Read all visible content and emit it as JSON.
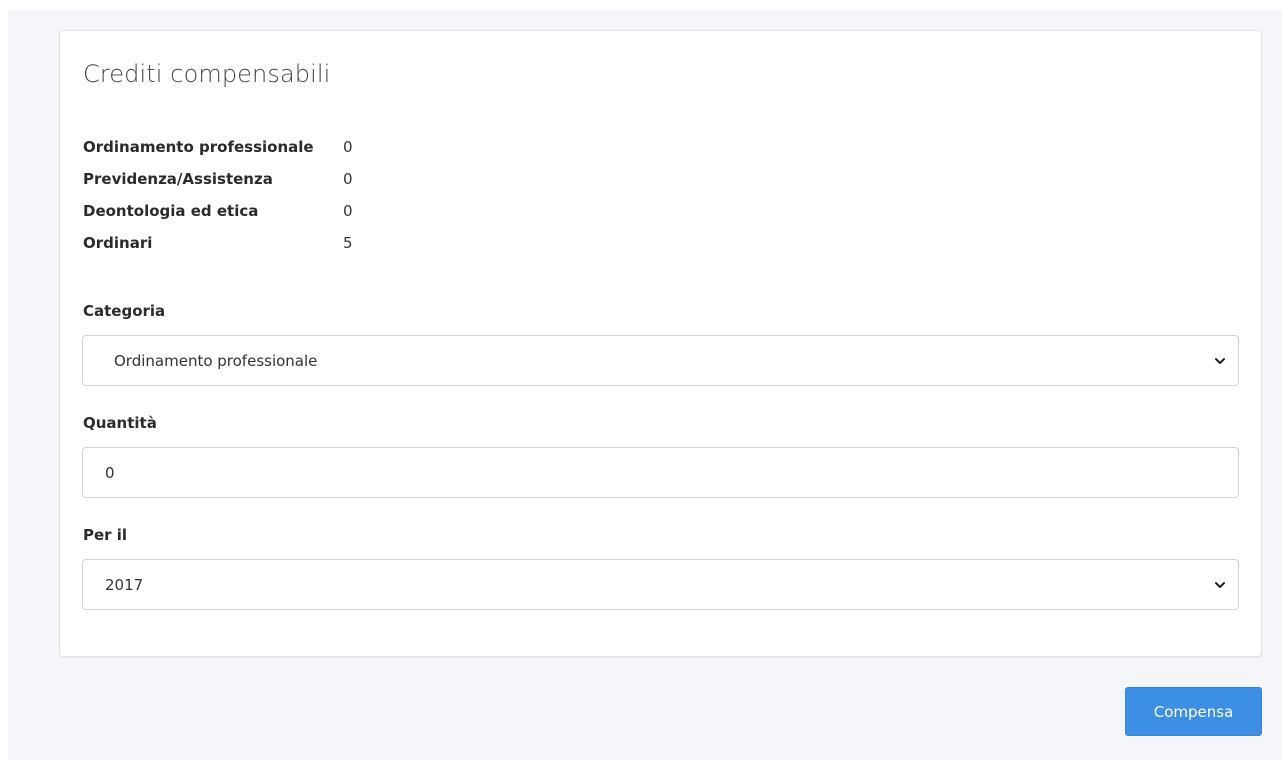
{
  "card": {
    "title": "Crediti compensabili",
    "stats": [
      {
        "label": "Ordinamento professionale",
        "value": "0"
      },
      {
        "label": "Previdenza/Assistenza",
        "value": "0"
      },
      {
        "label": "Deontologia ed etica",
        "value": "0"
      },
      {
        "label": "Ordinari",
        "value": "5"
      }
    ]
  },
  "form": {
    "categoria_label": "Categoria",
    "categoria_value": "Ordinamento professionale",
    "quantita_label": "Quantità",
    "quantita_value": "0",
    "per_il_label": "Per il",
    "per_il_value": "2017"
  },
  "actions": {
    "compensa_label": "Compensa"
  },
  "colors": {
    "background": "#f4f6f9",
    "primary_button": "#3d8fe6"
  },
  "icons": {
    "select_chevron": "chevron-down-icon"
  }
}
